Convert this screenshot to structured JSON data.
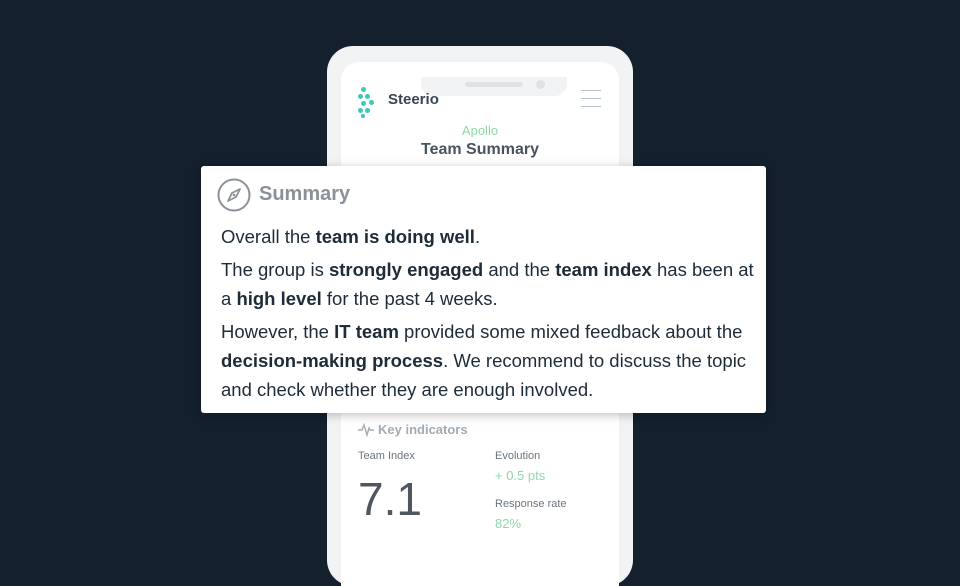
{
  "app": {
    "brand": "Steerio",
    "subtitle": "Apollo",
    "title": "Team Summary"
  },
  "summary_card": {
    "title": "Summary",
    "p1": {
      "a": "Overall the ",
      "b1": "team is doing well",
      "c": "."
    },
    "p2": {
      "a": "The group is ",
      "b1": "strongly engaged",
      "c": " and the ",
      "b2": "team index",
      "d": " has been at a ",
      "b3": "high level",
      "e": " for the past 4 weeks."
    },
    "p3": {
      "a": "However, the ",
      "b1": "IT team",
      "c": " provided some mixed feedback about the ",
      "b2": "decision-making process",
      "d": ". We recommend  to discuss the topic and check whether they are enough involved."
    }
  },
  "key_indicators": {
    "heading": "Key indicators",
    "team_index_label": "Team Index",
    "team_index_value": "7.1",
    "evolution_label": "Evolution",
    "evolution_value": "+ 0.5 pts",
    "response_rate_label": "Response rate",
    "response_rate_value": "82%"
  },
  "icons": {
    "logo": "steerio-logo-icon",
    "menu": "hamburger-menu-icon",
    "summary": "compass-icon",
    "key_indicators": "pulse-icon"
  },
  "colors": {
    "background": "#14202d",
    "accent_green": "#8fd9a8",
    "logo_teal": "#3cc9b5",
    "text_dark": "#1e2b38"
  }
}
